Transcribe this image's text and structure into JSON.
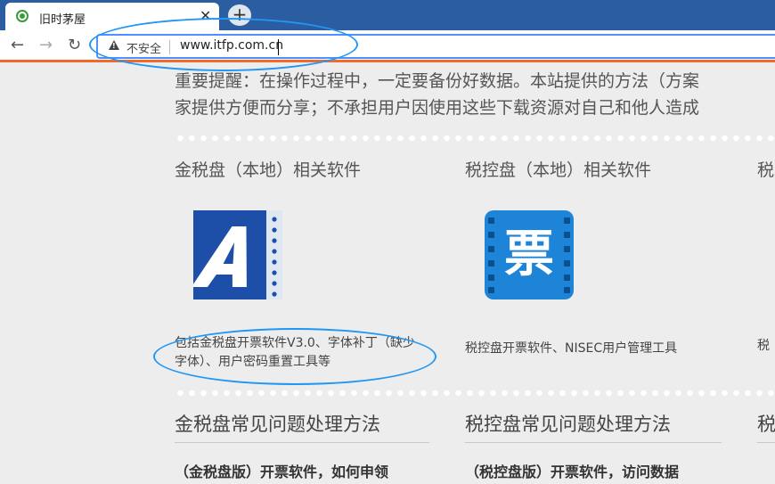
{
  "browser": {
    "tab_title": "旧时茅屋",
    "tab_close": "✕",
    "new_tab": "+",
    "back": "←",
    "forward": "→",
    "reload": "↻",
    "security_label": "不安全",
    "url": "www.itfp.com.cn"
  },
  "page": {
    "notice_line1": "重要提醒：在操作过程中，一定要备份好数据。本站提供的方法（方案",
    "notice_line2": "家提供方便而分享；不承担用户因使用这些下载资源对自己和他人造成",
    "columns": [
      {
        "title": "金税盘（本地）相关软件",
        "icon": "jinshui-app-icon",
        "description": "包括金税盘开票软件V3.0、字体补丁（缺少字体）、用户密码重置工具等",
        "section_title": "金税盘常见问题处理方法",
        "article": "（金税盘版）开票软件，如何申领"
      },
      {
        "title": "税控盘（本地）相关软件",
        "icon": "piao-app-icon",
        "icon_glyph": "票",
        "description": "税控盘开票软件、NISEC用户管理工具",
        "section_title": "税控盘常见问题处理方法",
        "article": "（税控盘版）开票软件，访问数据"
      },
      {
        "title": "税",
        "description": "税",
        "section_title": "税"
      }
    ]
  },
  "colors": {
    "chrome_blue": "#2a5ea0",
    "accent_orange": "#ef6a2b",
    "annotation_blue": "#2196f3",
    "icon_blue": "#1e4fa8"
  }
}
